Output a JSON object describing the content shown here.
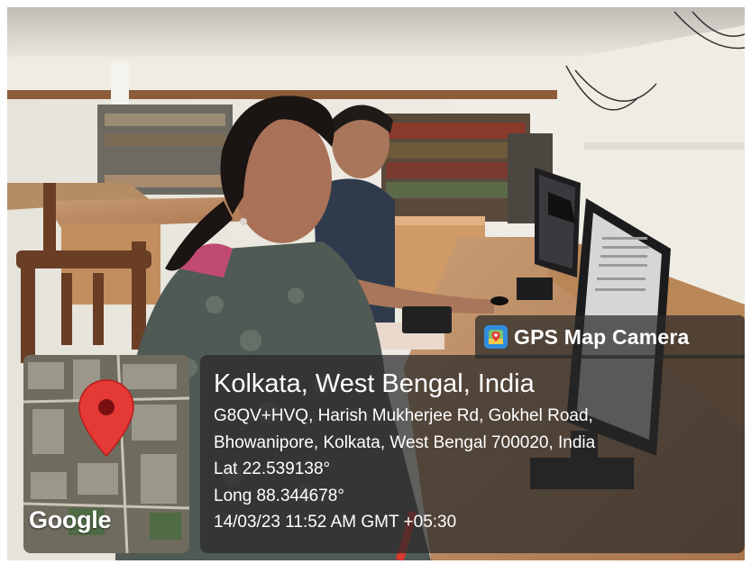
{
  "badge": {
    "label": "GPS Map Camera",
    "icon": "map-camera-icon"
  },
  "map": {
    "attribution": "Google",
    "pin_icon": "location-pin-icon"
  },
  "location": {
    "city": "Kolkata, West Bengal, India",
    "address_line1": "G8QV+HVQ, Harish Mukherjee Rd, Gokhel Road,",
    "address_line2": "Bhowanipore, Kolkata, West Bengal 700020, India",
    "lat": "Lat 22.539138°",
    "long": "Long 88.344678°",
    "timestamp": "14/03/23 11:52 AM GMT +05:30"
  },
  "colors": {
    "overlay": "#282828",
    "pin": "#e53935",
    "badge_icon": "#2f8de0"
  }
}
